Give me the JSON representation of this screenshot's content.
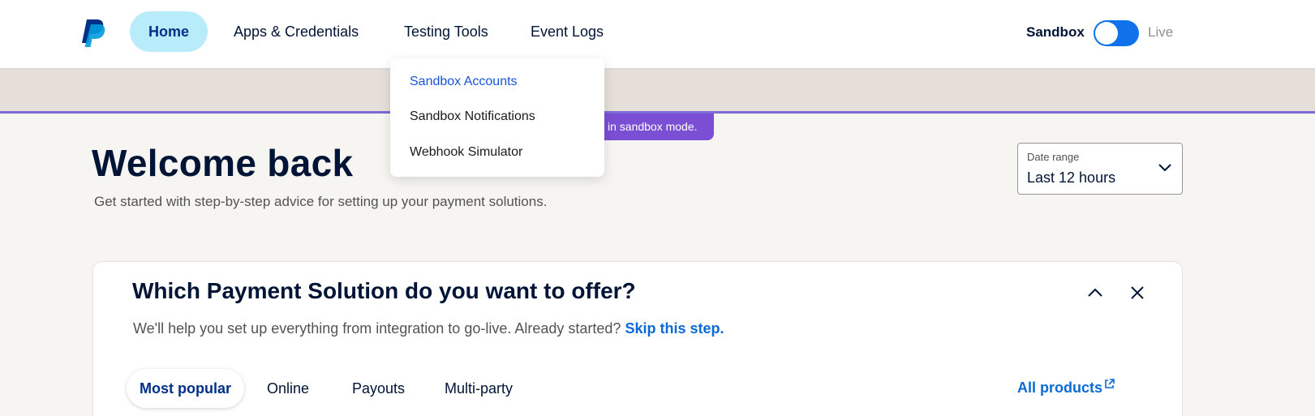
{
  "nav": {
    "items": [
      {
        "label": "Home"
      },
      {
        "label": "Apps & Credentials"
      },
      {
        "label": "Testing Tools"
      },
      {
        "label": "Event Logs"
      }
    ],
    "env_sandbox": "Sandbox",
    "env_live": "Live"
  },
  "testing_tools_menu": {
    "items": [
      {
        "label": "Sandbox Accounts"
      },
      {
        "label": "Sandbox Notifications"
      },
      {
        "label": "Webhook Simulator"
      }
    ]
  },
  "sandbox_banner": {
    "text": "in sandbox mode."
  },
  "welcome": {
    "title": "Welcome back",
    "subtitle": "Get started with step-by-step advice for setting up your payment solutions."
  },
  "date_range": {
    "label": "Date range",
    "value": "Last 12 hours"
  },
  "payment_card": {
    "title": "Which Payment Solution do you want to offer?",
    "subtitle": "We'll help you set up everything from integration to go-live. Already started?",
    "skip_link": "Skip this step.",
    "tabs": [
      {
        "label": "Most popular"
      },
      {
        "label": "Online"
      },
      {
        "label": "Payouts"
      },
      {
        "label": "Multi-party"
      }
    ],
    "all_products": "All products"
  },
  "colors": {
    "brand_navy": "#003087",
    "brand_blue": "#009cde",
    "link_blue": "#0b6bd6",
    "active_nav_bg": "#b9ecfb",
    "toggle_on": "#1072eb",
    "sandbox_purple": "#7a4fd4"
  }
}
